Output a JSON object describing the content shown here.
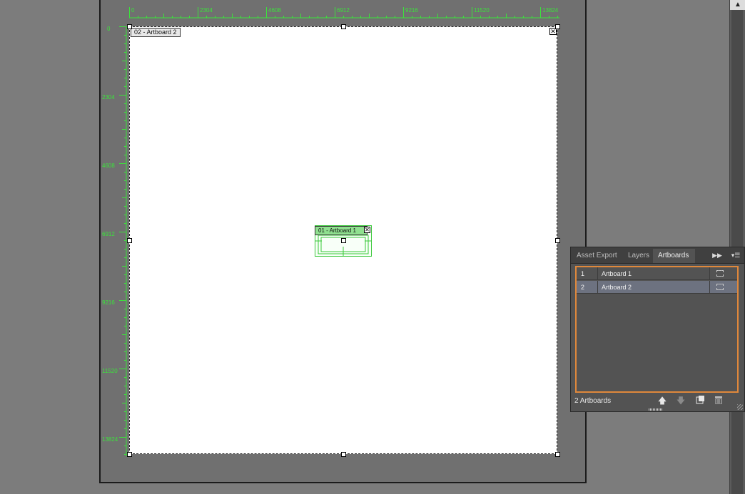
{
  "rulers": {
    "horizontal": [
      "0",
      "2304",
      "4608",
      "6912",
      "9216",
      "11520",
      "13824"
    ],
    "vertical": [
      "0",
      "2304",
      "4608",
      "6912",
      "9216",
      "11520",
      "13824"
    ]
  },
  "canvas": {
    "artboard2_label": "02 - Artboard 2",
    "artboard1_label": "01 - Artboard 1"
  },
  "panel": {
    "tabs": [
      "Asset Export",
      "Layers",
      "Artboards"
    ],
    "active_tab": "Artboards",
    "artboards": [
      {
        "num": "1",
        "name": "Artboard 1"
      },
      {
        "num": "2",
        "name": "Artboard 2"
      }
    ],
    "footer_count": "2 Artboards"
  },
  "icons": {
    "collapse": "double-chevron-right-icon",
    "menu": "panel-menu-icon",
    "move_up": "arrow-up-icon",
    "move_down": "arrow-down-icon",
    "new": "new-artboard-icon",
    "delete": "trash-icon"
  },
  "colors": {
    "accent": "#e0883b",
    "ruler": "#3ce23c",
    "selected_row": "#6d7280"
  }
}
